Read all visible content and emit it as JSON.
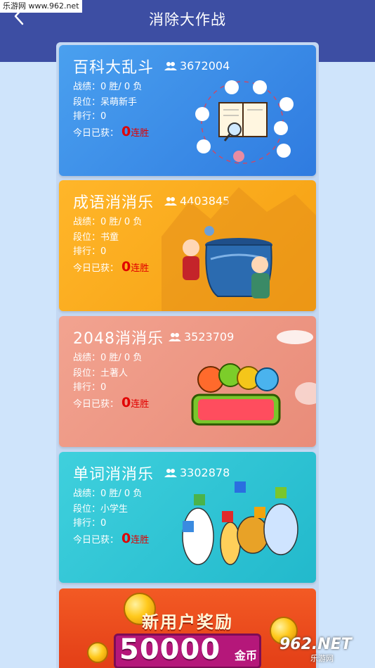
{
  "watermark_top": "乐游网 www.962.net",
  "header": {
    "title": "消除大作战"
  },
  "labels": {
    "record_prefix": "战绩：",
    "rank_level_prefix": "段位：",
    "ranking_prefix": "排行：",
    "today_prefix": "今日已获：",
    "streak_suffix": "连胜"
  },
  "games": [
    {
      "name": "百科大乱斗",
      "players": "3672004",
      "record": "0 胜/ 0 负",
      "rank_level": "呆萌新手",
      "ranking": "0",
      "today": "0"
    },
    {
      "name": "成语消消乐",
      "players": "4403845",
      "record": "0 胜/ 0 负",
      "rank_level": "书童",
      "ranking": "0",
      "today": "0"
    },
    {
      "name": "2048消消乐",
      "players": "3523709",
      "record": "0 胜/ 0 负",
      "rank_level": "土著人",
      "ranking": "0",
      "today": "0"
    },
    {
      "name": "单词消消乐",
      "players": "3302878",
      "record": "0 胜/ 0 负",
      "rank_level": "小学生",
      "ranking": "0",
      "today": "0"
    }
  ],
  "promo": {
    "headline": "新用户奖励",
    "amount": "50000",
    "unit": "金币"
  },
  "watermark_bottom": {
    "logo": "962.NET",
    "sub": "乐游网"
  },
  "colors": {
    "header": "#3d4ea3",
    "streak": "#e10000",
    "card1": "#3a8ce6",
    "card2": "#ffac1e",
    "card3": "#ee9a86",
    "card4": "#30c5d5"
  }
}
